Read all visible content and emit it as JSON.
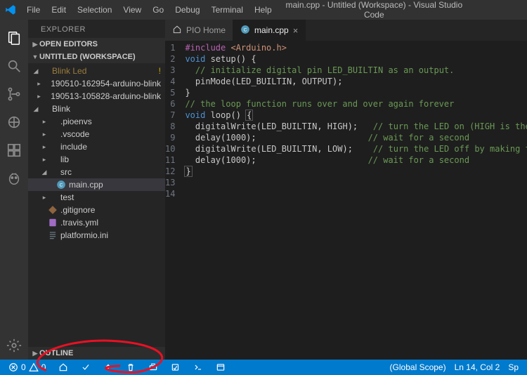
{
  "window_title": "main.cpp - Untitled (Workspace) - Visual Studio Code",
  "menu": {
    "items": [
      "File",
      "Edit",
      "Selection",
      "View",
      "Go",
      "Debug",
      "Terminal",
      "Help"
    ]
  },
  "sidebar": {
    "title": "EXPLORER",
    "open_editors_label": "OPEN EDITORS",
    "workspace_label": "UNTITLED (WORKSPACE)",
    "outline_label": "OUTLINE",
    "tree": [
      {
        "label": "Blink Led",
        "depth": 0,
        "kind": "folder",
        "expanded": true,
        "dim": true,
        "diag": "!"
      },
      {
        "label": "190510-162954-arduino-blink",
        "depth": 1,
        "kind": "folder",
        "expanded": false
      },
      {
        "label": "190513-105828-arduino-blink",
        "depth": 1,
        "kind": "folder",
        "expanded": false
      },
      {
        "label": "Blink",
        "depth": 0,
        "kind": "folder",
        "expanded": true
      },
      {
        "label": ".pioenvs",
        "depth": 1,
        "kind": "folder",
        "expanded": false
      },
      {
        "label": ".vscode",
        "depth": 1,
        "kind": "folder",
        "expanded": false
      },
      {
        "label": "include",
        "depth": 1,
        "kind": "folder",
        "expanded": false
      },
      {
        "label": "lib",
        "depth": 1,
        "kind": "folder",
        "expanded": false
      },
      {
        "label": "src",
        "depth": 1,
        "kind": "folder",
        "expanded": true
      },
      {
        "label": "main.cpp",
        "depth": 2,
        "kind": "file-cpp",
        "selected": true
      },
      {
        "label": "test",
        "depth": 1,
        "kind": "folder",
        "expanded": false
      },
      {
        "label": ".gitignore",
        "depth": 1,
        "kind": "file-git"
      },
      {
        "label": ".travis.yml",
        "depth": 1,
        "kind": "file-yml"
      },
      {
        "label": "platformio.ini",
        "depth": 1,
        "kind": "file-ini"
      }
    ]
  },
  "tabs": [
    {
      "label": "PIO Home",
      "icon": "home",
      "active": false,
      "closable": false
    },
    {
      "label": "main.cpp",
      "icon": "cpp",
      "active": true,
      "closable": true
    }
  ],
  "code": {
    "lines": 14,
    "tokens": [
      [
        [
          "inc",
          "#include "
        ],
        [
          "str",
          "<Arduino.h>"
        ]
      ],
      [],
      [
        [
          "kw",
          "void "
        ],
        [
          "fn",
          "setup"
        ],
        [
          "punc",
          "() {"
        ]
      ],
      [
        [
          "punc",
          "  "
        ],
        [
          "cmt",
          "// initialize digital pin LED_BUILTIN as an output."
        ]
      ],
      [
        [
          "punc",
          "  "
        ],
        [
          "fn",
          "pinMode"
        ],
        [
          "punc",
          "("
        ],
        [
          "const",
          "LED_BUILTIN"
        ],
        [
          "punc",
          ", "
        ],
        [
          "const",
          "OUTPUT"
        ],
        [
          "punc",
          ");"
        ]
      ],
      [
        [
          "punc",
          "}"
        ]
      ],
      [],
      [
        [
          "cmt",
          "// the loop function runs over and over again forever"
        ]
      ],
      [
        [
          "kw",
          "void "
        ],
        [
          "fn",
          "loop"
        ],
        [
          "punc",
          "() "
        ],
        [
          "boxopen",
          "{"
        ]
      ],
      [
        [
          "punc",
          "  "
        ],
        [
          "fn",
          "digitalWrite"
        ],
        [
          "punc",
          "("
        ],
        [
          "const",
          "LED_BUILTIN"
        ],
        [
          "punc",
          ", "
        ],
        [
          "const",
          "HIGH"
        ],
        [
          "punc",
          ");   "
        ],
        [
          "cmt",
          "// turn the LED on (HIGH is the voltage level)"
        ]
      ],
      [
        [
          "punc",
          "  "
        ],
        [
          "fn",
          "delay"
        ],
        [
          "punc",
          "("
        ],
        [
          "const",
          "1000"
        ],
        [
          "punc",
          ");                      "
        ],
        [
          "cmt",
          "// wait for a second"
        ]
      ],
      [
        [
          "punc",
          "  "
        ],
        [
          "fn",
          "digitalWrite"
        ],
        [
          "punc",
          "("
        ],
        [
          "const",
          "LED_BUILTIN"
        ],
        [
          "punc",
          ", "
        ],
        [
          "const",
          "LOW"
        ],
        [
          "punc",
          ");    "
        ],
        [
          "cmt",
          "// turn the LED off by making the voltage LOW"
        ]
      ],
      [
        [
          "punc",
          "  "
        ],
        [
          "fn",
          "delay"
        ],
        [
          "punc",
          "("
        ],
        [
          "const",
          "1000"
        ],
        [
          "punc",
          ");                      "
        ],
        [
          "cmt",
          "// wait for a second"
        ]
      ],
      [
        [
          "boxclose",
          "}"
        ]
      ]
    ]
  },
  "status": {
    "errors": "0",
    "warnings": "0",
    "scope": "(Global Scope)",
    "cursor": "Ln 14, Col 2",
    "spaces": "Sp"
  },
  "activity": {
    "items": [
      "explorer",
      "search",
      "scm",
      "debug",
      "extensions",
      "platformio"
    ],
    "bottom": "settings"
  },
  "pio_icons": [
    "home",
    "build",
    "upload",
    "clean",
    "serial",
    "run-task",
    "terminal",
    "new-terminal"
  ]
}
